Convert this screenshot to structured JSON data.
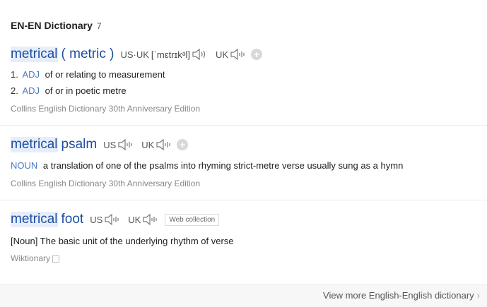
{
  "header": {
    "title": "EN-EN Dictionary",
    "count": "7"
  },
  "entries": [
    {
      "word_main": "metrical",
      "word_rest": "( metric )",
      "pron_label": "US·UK",
      "pron": "[ˈmɛtrɪkᵊl]",
      "uk_label": "UK",
      "defs": [
        {
          "num": "1.",
          "pos": "ADJ",
          "text": "of or relating to measurement"
        },
        {
          "num": "2.",
          "pos": "ADJ",
          "text": "of or in poetic metre"
        }
      ],
      "source": "Collins English Dictionary 30th Anniversary Edition"
    },
    {
      "word_main": "metrical",
      "word_rest": "psalm",
      "us_label": "US",
      "uk_label": "UK",
      "defs": [
        {
          "pos": "NOUN",
          "text": "a translation of one of the psalms into rhyming strict-metre verse usually sung as a hymn"
        }
      ],
      "source": "Collins English Dictionary 30th Anniversary Edition"
    },
    {
      "word_main": "metrical",
      "word_rest": "foot",
      "us_label": "US",
      "uk_label": "UK",
      "tag": "Web collection",
      "defs": [
        {
          "text": "[Noun] The basic unit of the underlying rhythm of verse"
        }
      ],
      "source": "Wiktionary"
    }
  ],
  "footer": {
    "more_label": "View more English-English dictionary",
    "chevron": "›"
  },
  "icons": {
    "speaker": "speaker-icon",
    "add": "add-icon",
    "external": "external-link-icon",
    "chevron": "chevron-right-icon"
  },
  "colors": {
    "word": "#1c4d9f",
    "highlight": "#e6eefc",
    "pos": "#4a7bc4",
    "source": "#888888"
  }
}
